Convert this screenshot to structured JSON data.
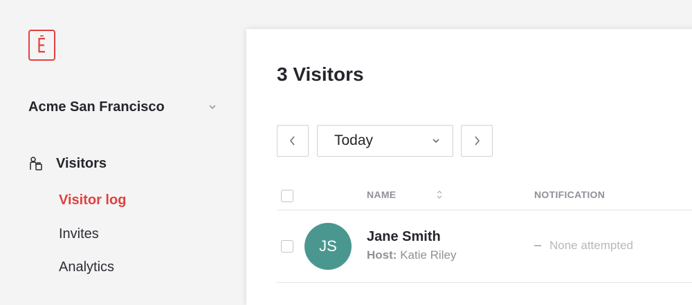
{
  "brand": {
    "accent": "#e0413f",
    "avatar_color": "#4a9790"
  },
  "sidebar": {
    "location": "Acme San Francisco",
    "section": {
      "label": "Visitors",
      "icon": "visitors-icon"
    },
    "items": [
      {
        "label": "Visitor log",
        "active": true
      },
      {
        "label": "Invites",
        "active": false
      },
      {
        "label": "Analytics",
        "active": false
      }
    ]
  },
  "main": {
    "title": "3 Visitors",
    "date_filter": {
      "value": "Today"
    },
    "table": {
      "columns": [
        "NAME",
        "NOTIFICATION"
      ],
      "rows": [
        {
          "initials": "JS",
          "name": "Jane Smith",
          "host_label": "Host:",
          "host": "Katie Riley",
          "notification": "None attempted"
        }
      ]
    }
  }
}
